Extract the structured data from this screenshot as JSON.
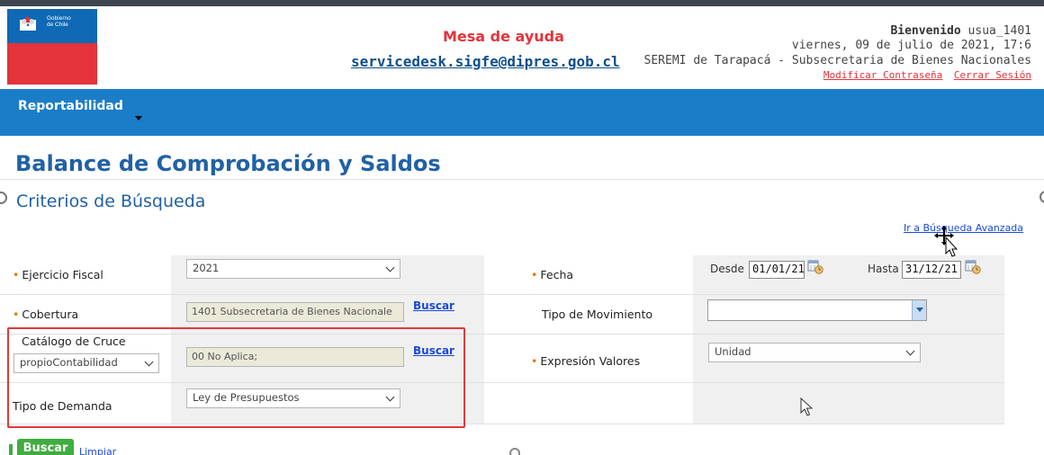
{
  "header": {
    "logo_text_line1": "Gobierno",
    "logo_text_line2": "de Chile",
    "helpdesk_title": "Mesa de ayuda",
    "helpdesk_email": "servicedesk.sigfe@dipres.gob.cl",
    "welcome_label": "Bienvenido",
    "username": "usua_1401",
    "date_text": "viernes, 09 de julio de 2021, 17:6",
    "organization": "SEREMI de Tarapacá - Subsecretaria de Bienes Nacionales",
    "change_password": "Modificar Contraseña",
    "logout": "Cerrar Sesión"
  },
  "nav": {
    "menu_item": "Reportabilidad"
  },
  "page": {
    "title": "Balance de Comprobación y Saldos",
    "section_title": "Criterios de Búsqueda",
    "advanced_search_link": "Ir a Búsqueda Avanzada"
  },
  "form": {
    "ejercicio_fiscal": {
      "label": "Ejercicio Fiscal",
      "value": "2021"
    },
    "cobertura": {
      "label": "Cobertura",
      "value": "1401 Subsecretaria de Bienes Nacionale",
      "search_link": "Buscar"
    },
    "catalogo_cruce": {
      "label": "Catálogo de Cruce",
      "selector_value": "propioContabilidad",
      "value": "00 No Aplica;",
      "search_link": "Buscar"
    },
    "tipo_demanda": {
      "label": "Tipo de Demanda",
      "value": "Ley de Presupuestos"
    },
    "fecha": {
      "label": "Fecha",
      "desde_label": "Desde",
      "desde_value": "01/01/21",
      "hasta_label": "Hasta",
      "hasta_value": "31/12/21"
    },
    "tipo_movimiento": {
      "label": "Tipo de Movimiento",
      "value": ""
    },
    "expresion_valores": {
      "label": "Expresión Valores",
      "value": "Unidad"
    }
  },
  "actions": {
    "search_button": "Buscar",
    "clear_link": "Limpiar"
  },
  "colors": {
    "brand_blue": "#1b7dc7",
    "title_blue": "#2161a6",
    "required_orange": "#e07b00",
    "highlight_red": "#e03a3a",
    "button_green": "#3fad3f"
  }
}
